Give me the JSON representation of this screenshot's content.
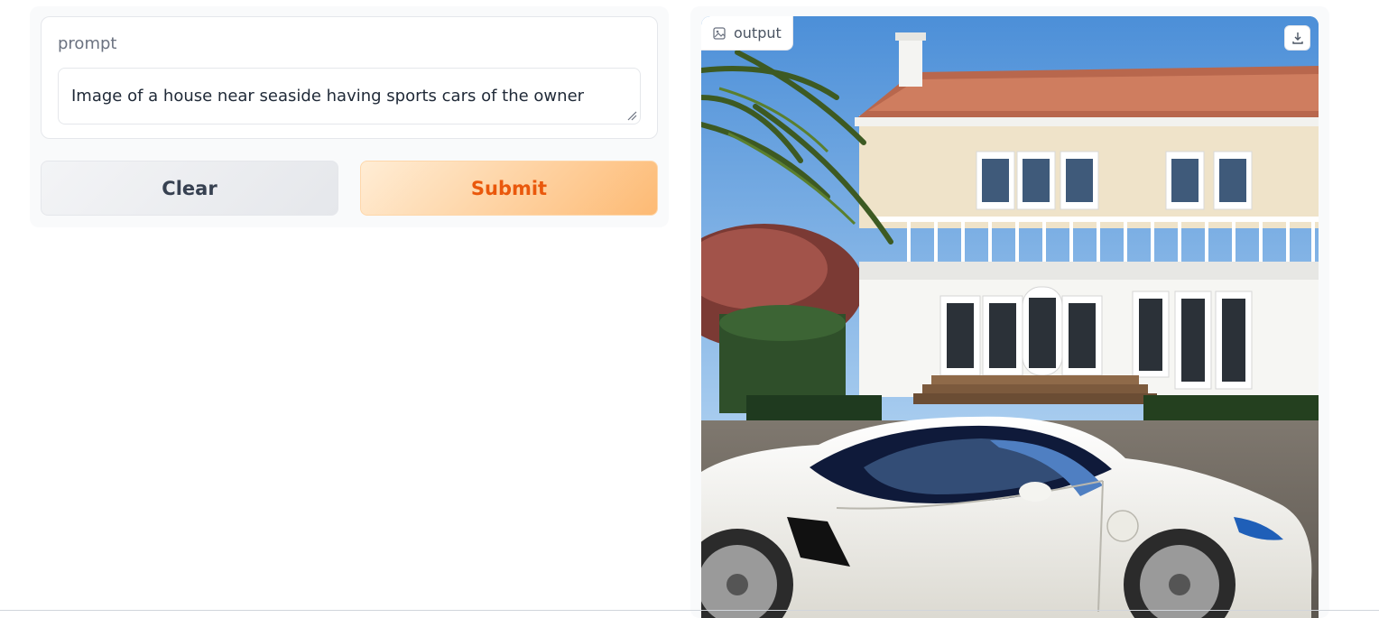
{
  "prompt": {
    "label": "prompt",
    "value": "Image of a house near seaside having sports cars of the owner"
  },
  "buttons": {
    "clear_label": "Clear",
    "submit_label": "Submit"
  },
  "output": {
    "label": "output",
    "image_icon": "image-icon",
    "download_icon": "download-icon"
  },
  "colors": {
    "accent": "#ea580c",
    "submit_bg": "#fdba74",
    "panel_bg": "#f9fafb"
  }
}
